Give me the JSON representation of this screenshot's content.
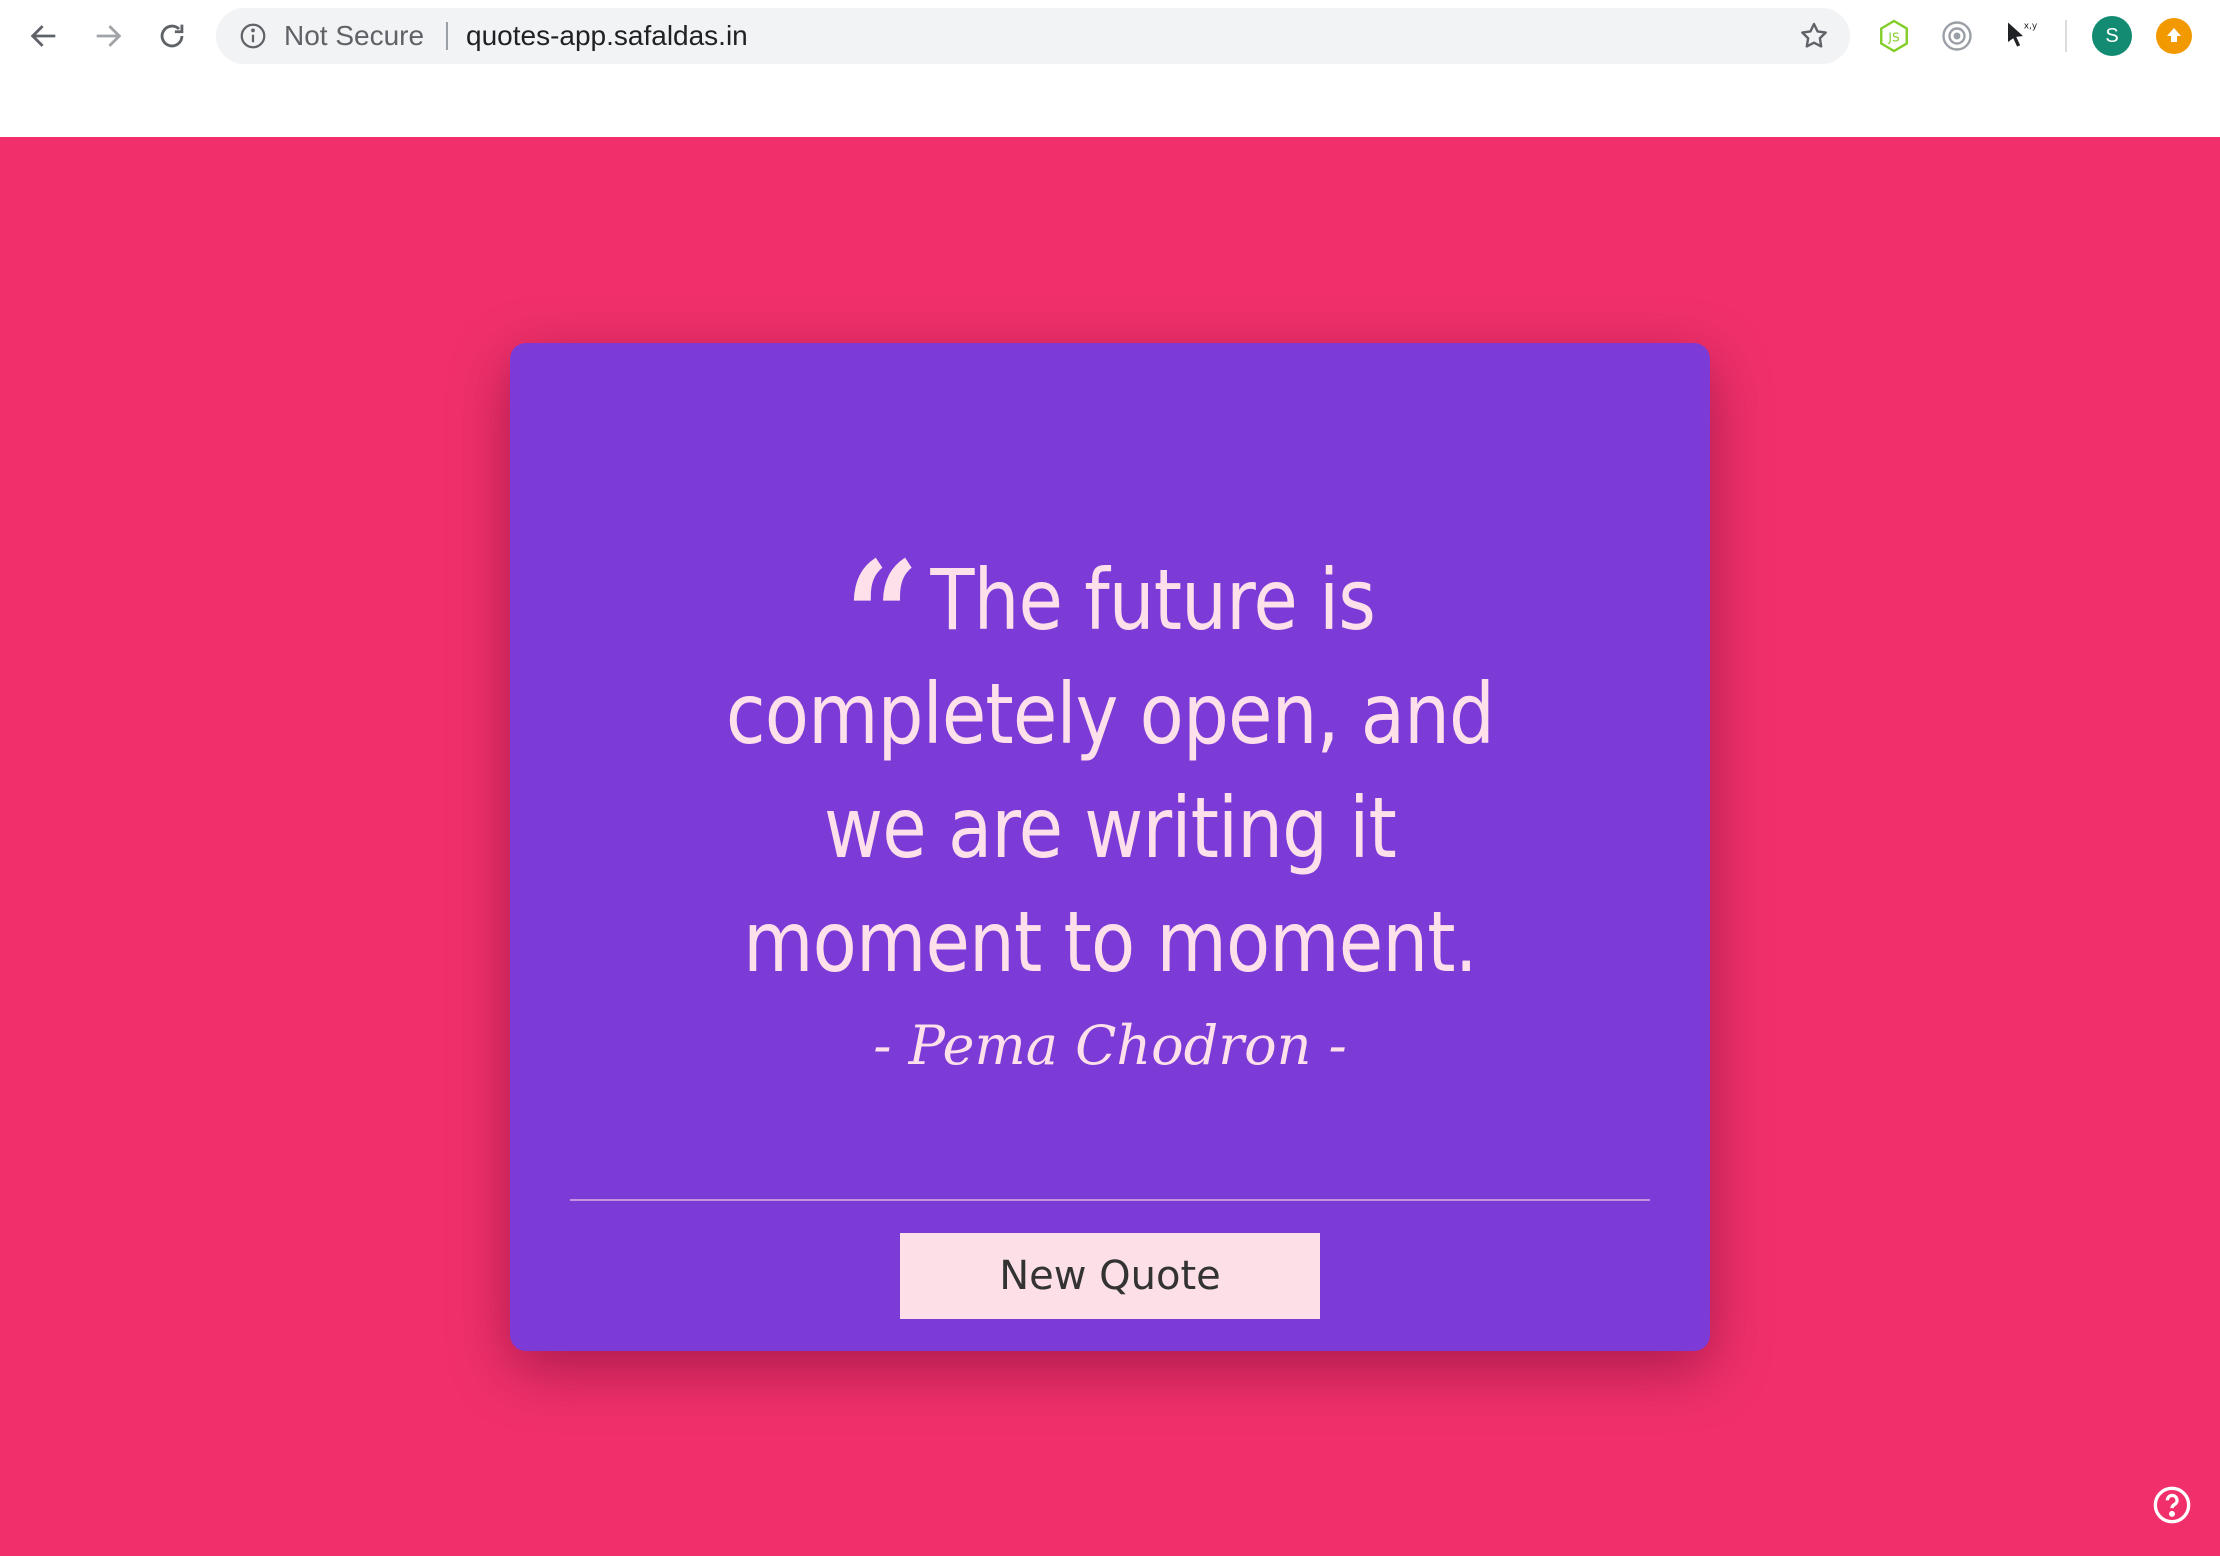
{
  "browser": {
    "security_label": "Not Secure",
    "url": "quotes-app.safaldas.in",
    "profile_initial": "S",
    "extension_cursor_label": "x,y"
  },
  "quote": {
    "mark": "“",
    "text": "The future is completely open, and we are writing it moment to moment.",
    "author": "- Pema Chodron -"
  },
  "actions": {
    "new_quote_label": "New Quote"
  },
  "colors": {
    "page_background": "#f1306b",
    "card_background": "#7c3ad6",
    "text_color": "#fde0ea",
    "button_background": "#fcdfe7"
  }
}
